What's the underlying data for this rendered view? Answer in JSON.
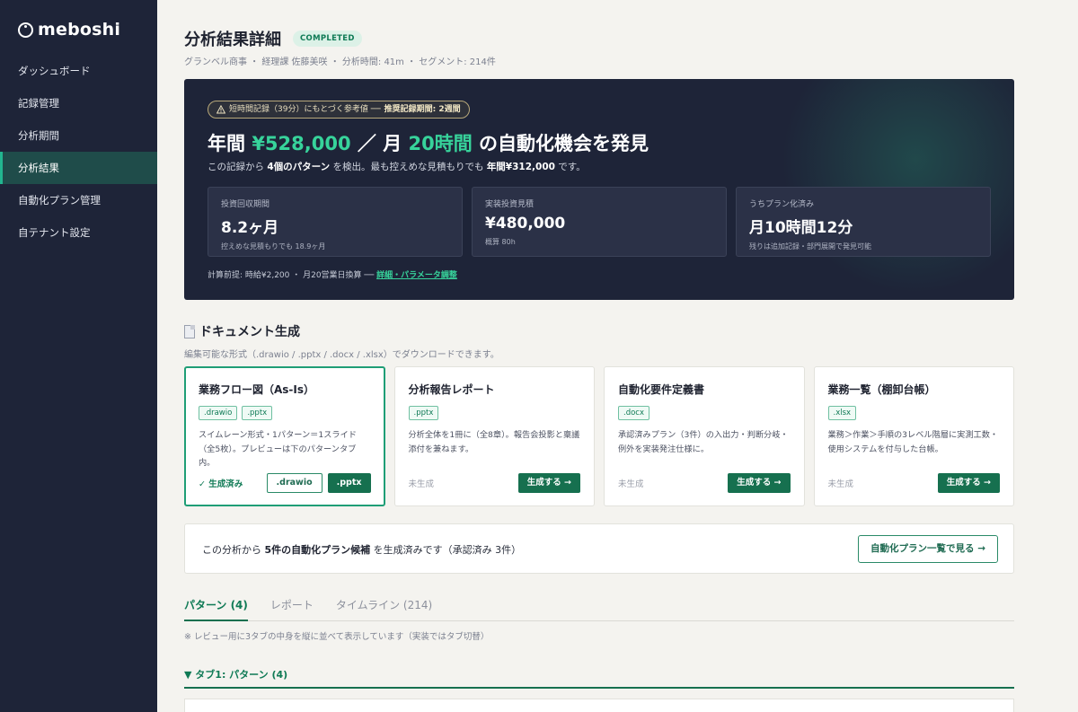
{
  "brand": {
    "name": "meboshi"
  },
  "sidebar": {
    "items": [
      {
        "label": "ダッシュボード"
      },
      {
        "label": "記録管理"
      },
      {
        "label": "分析期間"
      },
      {
        "label": "分析結果"
      },
      {
        "label": "自動化プラン管理"
      },
      {
        "label": "自テナント設定"
      }
    ],
    "active_index": 3
  },
  "header": {
    "title": "分析結果詳細",
    "status": "COMPLETED",
    "subtitle": "グランベル商事 ・ 経理課 佐藤美咲 ・ 分析時間: 41m ・ セグメント: 214件"
  },
  "hero": {
    "notice_icon": "warning-icon",
    "notice_text": "短時間記録（39分）にもとづく参考値 ── ",
    "notice_strong": "推奨記録期間: 2週間",
    "headline_prefix": "年間 ",
    "headline_amount": "¥528,000",
    "headline_mid": " ／ 月 ",
    "headline_hours": "20時間",
    "headline_suffix": " の自動化機会を発見",
    "desc_1": "この記録から ",
    "desc_patterns": "4個のパターン",
    "desc_2": " を検出。最も控えめな見積もりでも ",
    "desc_min": "年間¥312,000",
    "desc_3": " です。",
    "metrics": [
      {
        "label": "投資回収期間",
        "value": "8.2ヶ月",
        "note": "控えめな見積もりでも 18.9ヶ月"
      },
      {
        "label": "実装投資見積",
        "value": "¥480,000",
        "note": "概算 80h"
      },
      {
        "label": "うちプラン化済み",
        "value": "月10時間12分",
        "note": "残りは追加記録・部門展開で発見可能"
      }
    ],
    "footer_text": "計算前提: 時給¥2,200 ・ 月20営業日換算 ── ",
    "footer_link": "詳細・パラメータ調整"
  },
  "documents": {
    "title": "ドキュメント生成",
    "icon": "document-icon",
    "subtitle": "編集可能な形式（.drawio / .pptx / .docx / .xlsx）でダウンロードできます。",
    "cards": [
      {
        "title": "業務フロー図（As-Is）",
        "tags": [
          ".drawio",
          ".pptx"
        ],
        "desc": "スイムレーン形式・1パターン＝1スライド（全5枚）。プレビューは下のパターンタブ内。",
        "status": "✓ 生成済み",
        "buttons": [
          ".drawio",
          ".pptx"
        ]
      },
      {
        "title": "分析報告レポート",
        "tags": [
          ".pptx"
        ],
        "desc": "分析全体を1冊に（全8章）。報告会投影と稟議添付を兼ねます。",
        "status": "未生成",
        "button": "生成する →"
      },
      {
        "title": "自動化要件定義書",
        "tags": [
          ".docx"
        ],
        "desc": "承認済みプラン（3件）の入出力・判断分岐・例外を実装発注仕様に。",
        "status": "未生成",
        "button": "生成する →"
      },
      {
        "title": "業務一覧（棚卸台帳）",
        "tags": [
          ".xlsx"
        ],
        "desc": "業務＞作業＞手順の3レベル階層に実測工数・使用システムを付与した台帳。",
        "status": "未生成",
        "button": "生成する →"
      }
    ]
  },
  "plan_banner": {
    "text_1": "この分析から ",
    "text_strong": "5件の自動化プラン候補",
    "text_2": " を生成済みです（承認済み 3件）",
    "button": "自動化プラン一覧で見る →"
  },
  "tabs": [
    {
      "label": "パターン (4)"
    },
    {
      "label": "レポート"
    },
    {
      "label": "タイムライン (214)"
    }
  ],
  "tabs_note": "※ レビュー用に3タブの中身を縦に並べて表示しています（実装ではタブ切替）",
  "section_head": "▼ タブ1: パターン (4)",
  "colors": {
    "accent": "#37d39b",
    "primary": "#16704f",
    "sidebar_bg": "#1e2438",
    "page_bg": "#f4f3ef"
  }
}
